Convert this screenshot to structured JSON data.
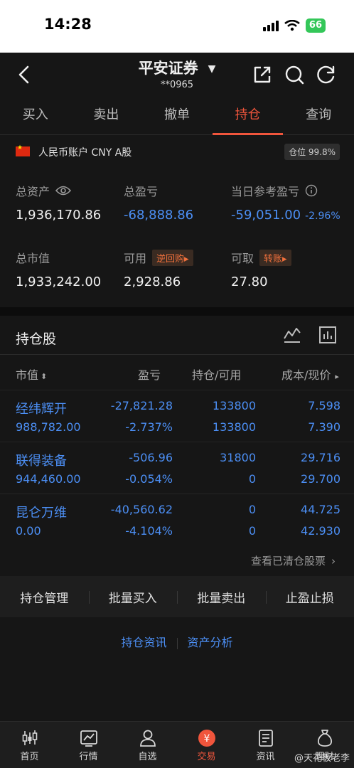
{
  "status_bar": {
    "time": "14:28",
    "battery": "66"
  },
  "nav": {
    "title": "平安证券",
    "account": "**0965"
  },
  "tabs": [
    "买入",
    "卖出",
    "撤单",
    "持仓",
    "查询"
  ],
  "account": {
    "label": "人民币账户 CNY A股",
    "position_badge": "仓位 99.8%"
  },
  "metrics": {
    "total_assets_label": "总资产",
    "total_assets": "1,936,170.86",
    "total_pl_label": "总盈亏",
    "total_pl": "-68,888.86",
    "day_pl_label": "当日参考盈亏",
    "day_pl": "-59,051.00",
    "day_pl_pct": "-2.96%",
    "market_value_label": "总市值",
    "market_value": "1,933,242.00",
    "available_label": "可用",
    "reverse_repo_link": "逆回购",
    "available": "2,928.86",
    "withdrawable_label": "可取",
    "transfer_link": "转账",
    "withdrawable": "27.80"
  },
  "holdings": {
    "title": "持仓股",
    "columns": [
      "市值",
      "盈亏",
      "持仓/可用",
      "成本/现价"
    ],
    "rows": [
      {
        "name": "经纬辉开",
        "market_value": "988,782.00",
        "pl": "-27,821.28",
        "pl_pct": "-2.737%",
        "hold": "133800",
        "avail": "133800",
        "cost": "7.598",
        "price": "7.390"
      },
      {
        "name": "联得装备",
        "market_value": "944,460.00",
        "pl": "-506.96",
        "pl_pct": "-0.054%",
        "hold": "31800",
        "avail": "0",
        "cost": "29.716",
        "price": "29.700"
      },
      {
        "name": "昆仑万维",
        "market_value": "0.00",
        "pl": "-40,560.62",
        "pl_pct": "-4.104%",
        "hold": "0",
        "avail": "0",
        "cost": "44.725",
        "price": "42.930"
      }
    ],
    "cleared_link": "查看已清仓股票"
  },
  "actions": [
    "持仓管理",
    "批量买入",
    "批量卖出",
    "止盈止损"
  ],
  "links": [
    "持仓资讯",
    "资产分析"
  ],
  "bottom_nav": [
    "首页",
    "行情",
    "自选",
    "交易",
    "资讯",
    "理财"
  ],
  "watermark": "@天花板老李",
  "colors": {
    "accent": "#f0553c",
    "loss": "#4c8ff5",
    "background": "#161616"
  }
}
